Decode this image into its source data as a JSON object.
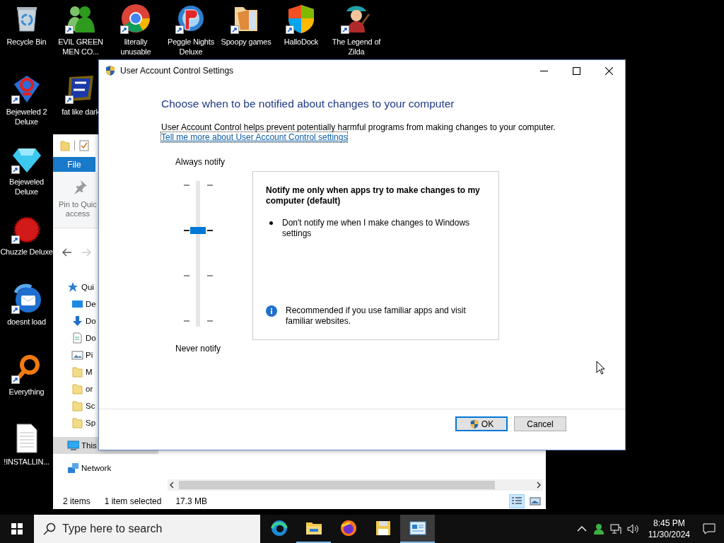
{
  "desktop": {
    "columns": [
      [
        {
          "label": "Recycle Bin",
          "shortcut": false
        },
        {
          "label": "Bejeweled 2 Deluxe",
          "shortcut": true
        },
        {
          "label": "Bejeweled Deluxe",
          "shortcut": true
        },
        {
          "label": "Chuzzle Deluxe",
          "shortcut": true
        },
        {
          "label": "doesnt load",
          "shortcut": true
        },
        {
          "label": "Everything",
          "shortcut": true
        },
        {
          "label": "!INSTALLIN...",
          "shortcut": false
        }
      ],
      [
        {
          "label": "EVIL GREEN MEN CO...",
          "shortcut": true
        },
        {
          "label": "fat like dark",
          "shortcut": true
        }
      ],
      [
        {
          "label": "literally unusable",
          "shortcut": true
        }
      ],
      [
        {
          "label": "Peggle Nights Deluxe",
          "shortcut": true
        }
      ],
      [
        {
          "label": "Spoopy games",
          "shortcut": true
        }
      ],
      [
        {
          "label": "HalloDock",
          "shortcut": true
        }
      ],
      [
        {
          "label": "The Legend of Zilda",
          "shortcut": true
        }
      ]
    ]
  },
  "explorer": {
    "ribbon_tab": "File",
    "pin_button": [
      "Pin to Quic",
      "access"
    ],
    "nav": [
      {
        "label": "Qui",
        "kind": "quick",
        "selected": false,
        "children": [
          {
            "label": "De",
            "kind": "desktop",
            "selected": false
          },
          {
            "label": "Do",
            "kind": "downloads",
            "selected": false
          },
          {
            "label": "Do",
            "kind": "documents",
            "selected": false
          },
          {
            "label": "Pi",
            "kind": "pictures",
            "selected": false
          },
          {
            "label": "M",
            "kind": "folder",
            "selected": false
          },
          {
            "label": "or",
            "kind": "folder",
            "selected": false
          },
          {
            "label": "Sc",
            "kind": "folder",
            "selected": false
          },
          {
            "label": "Sp",
            "kind": "folder",
            "selected": false
          }
        ]
      },
      {
        "label": "This",
        "kind": "pc",
        "selected": true
      },
      {
        "label": "Network",
        "kind": "network",
        "selected": false
      }
    ],
    "status": [
      "2 items",
      "1 item selected",
      "17.3 MB"
    ],
    "views": [
      {
        "kind": "details",
        "selected": true
      },
      {
        "kind": "large",
        "selected": false
      }
    ]
  },
  "dialog": {
    "title": "User Account Control Settings",
    "heading": "Choose when to be notified about changes to your computer",
    "description": "User Account Control helps prevent potentially harmful programs from making changes to your computer.",
    "link": "Tell me more about User Account Control settings",
    "slider": {
      "top_label": "Always notify",
      "bottom_label": "Never notify",
      "level": 0.667
    },
    "panel": {
      "title": "Notify me only when apps try to make changes to my computer (default)",
      "bullets": [
        "Don't notify me when I make changes to Windows settings"
      ],
      "note": "Recommended if you use familiar apps and visit familiar websites."
    },
    "buttons": [
      {
        "label": "OK",
        "kind": "shield",
        "focused": true
      },
      {
        "label": "Cancel",
        "kind": "plain",
        "focused": false
      }
    ]
  },
  "taskbar": {
    "search": {
      "placeholder": "Type here to search"
    },
    "apps": [
      {
        "kind": "swirl",
        "open": false,
        "active": false
      },
      {
        "kind": "folder",
        "open": true,
        "active": false
      },
      {
        "kind": "globe",
        "open": false,
        "active": false
      },
      {
        "kind": "floppy",
        "open": false,
        "active": false
      },
      {
        "kind": "window",
        "open": true,
        "active": true
      }
    ],
    "time": "8:45 PM",
    "date": "11/30/2024"
  }
}
